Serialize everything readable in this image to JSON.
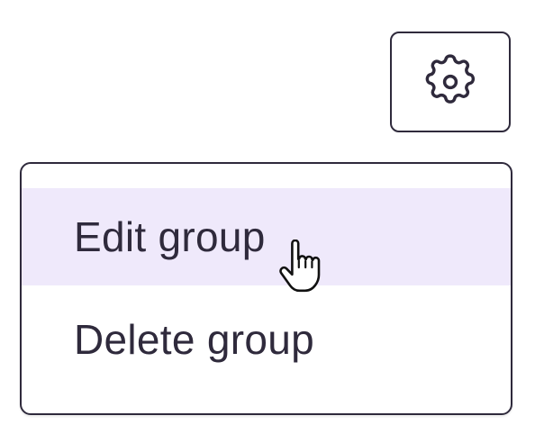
{
  "toolbar": {
    "settings_icon": "gear-icon"
  },
  "menu": {
    "items": [
      {
        "label": "Edit group",
        "hovered": true
      },
      {
        "label": "Delete group",
        "hovered": false
      }
    ]
  },
  "colors": {
    "text": "#2f2a3c",
    "hover_background": "#efe9fb",
    "border": "#2f2a3c"
  },
  "cursor": {
    "icon": "pointer-hand-icon"
  }
}
